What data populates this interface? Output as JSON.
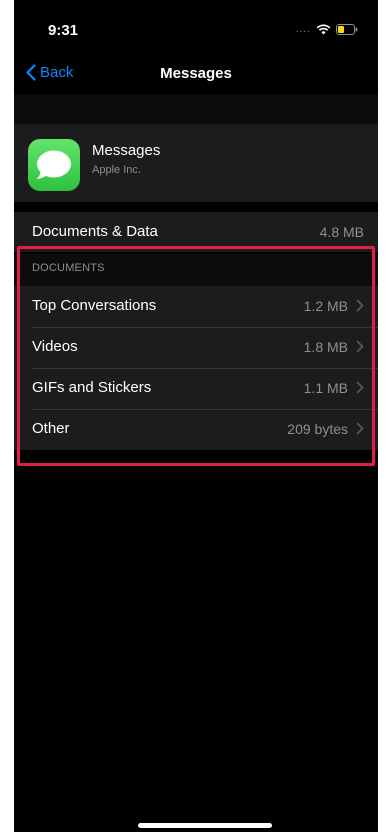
{
  "status_bar": {
    "time": "9:31",
    "signal": "....",
    "icons": [
      "wifi-icon",
      "battery-icon"
    ]
  },
  "nav": {
    "back_label": "Back",
    "title": "Messages",
    "accent_color": "#0a84ff"
  },
  "app": {
    "name": "Messages",
    "vendor": "Apple Inc.",
    "icon": "messages-app-icon",
    "icon_color": "#34c759"
  },
  "documents_and_data": {
    "label": "Documents & Data",
    "value": "4.8 MB"
  },
  "documents_section": {
    "header": "DOCUMENTS",
    "highlight_color": "#e11d48",
    "items": [
      {
        "label": "Top Conversations",
        "value": "1.2 MB"
      },
      {
        "label": "Videos",
        "value": "1.8 MB"
      },
      {
        "label": "GIFs and Stickers",
        "value": "1.1 MB"
      },
      {
        "label": "Other",
        "value": "209 bytes"
      }
    ]
  }
}
